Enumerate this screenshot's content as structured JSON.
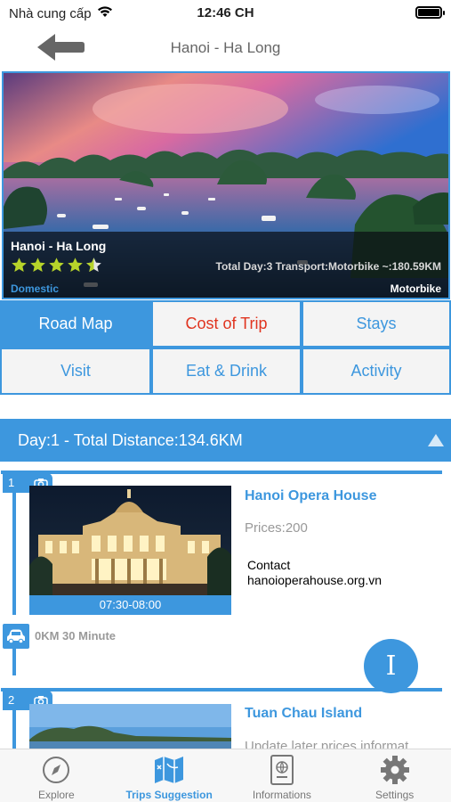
{
  "status_bar": {
    "carrier": "Nhà cung cấp",
    "time": "12:46 CH"
  },
  "navbar": {
    "title": "Hanoi - Ha Long"
  },
  "hero": {
    "name": "Hanoi - Ha Long",
    "rating": 4.5,
    "summary": "Total Day:3 Transport:Motorbike   ~:180.59KM",
    "category": "Domestic",
    "transport": "Motorbike"
  },
  "menu": {
    "items": [
      {
        "label": "Road Map"
      },
      {
        "label": "Cost of Trip"
      },
      {
        "label": "Stays"
      },
      {
        "label": "Visit"
      },
      {
        "label": "Eat & Drink"
      },
      {
        "label": "Activity"
      }
    ]
  },
  "day": {
    "header": "Day:1 - Total Distance:134.6KM"
  },
  "places": [
    {
      "index": "1",
      "name": "Hanoi Opera House",
      "prices": "Prices:200",
      "contact_label": "Contact",
      "contact_value": "hanoioperahouse.org.vn",
      "time": "07:30-08:00"
    },
    {
      "index": "2",
      "name": "Tuan Chau Island",
      "prices": "Update later prices informat"
    }
  ],
  "travel": {
    "text": "0KM 30 Minute"
  },
  "fab": {
    "label": "I"
  },
  "tabbar": {
    "tabs": [
      {
        "label": "Explore",
        "icon": "compass-icon"
      },
      {
        "label": "Trips Suggestion",
        "icon": "map-icon"
      },
      {
        "label": "Informations",
        "icon": "passport-icon"
      },
      {
        "label": "Settings",
        "icon": "gear-icon"
      }
    ],
    "active": "Trips Suggestion"
  },
  "colors": {
    "accent": "#3d97de",
    "cost": "#e0341f",
    "star": "#b7d42a"
  }
}
